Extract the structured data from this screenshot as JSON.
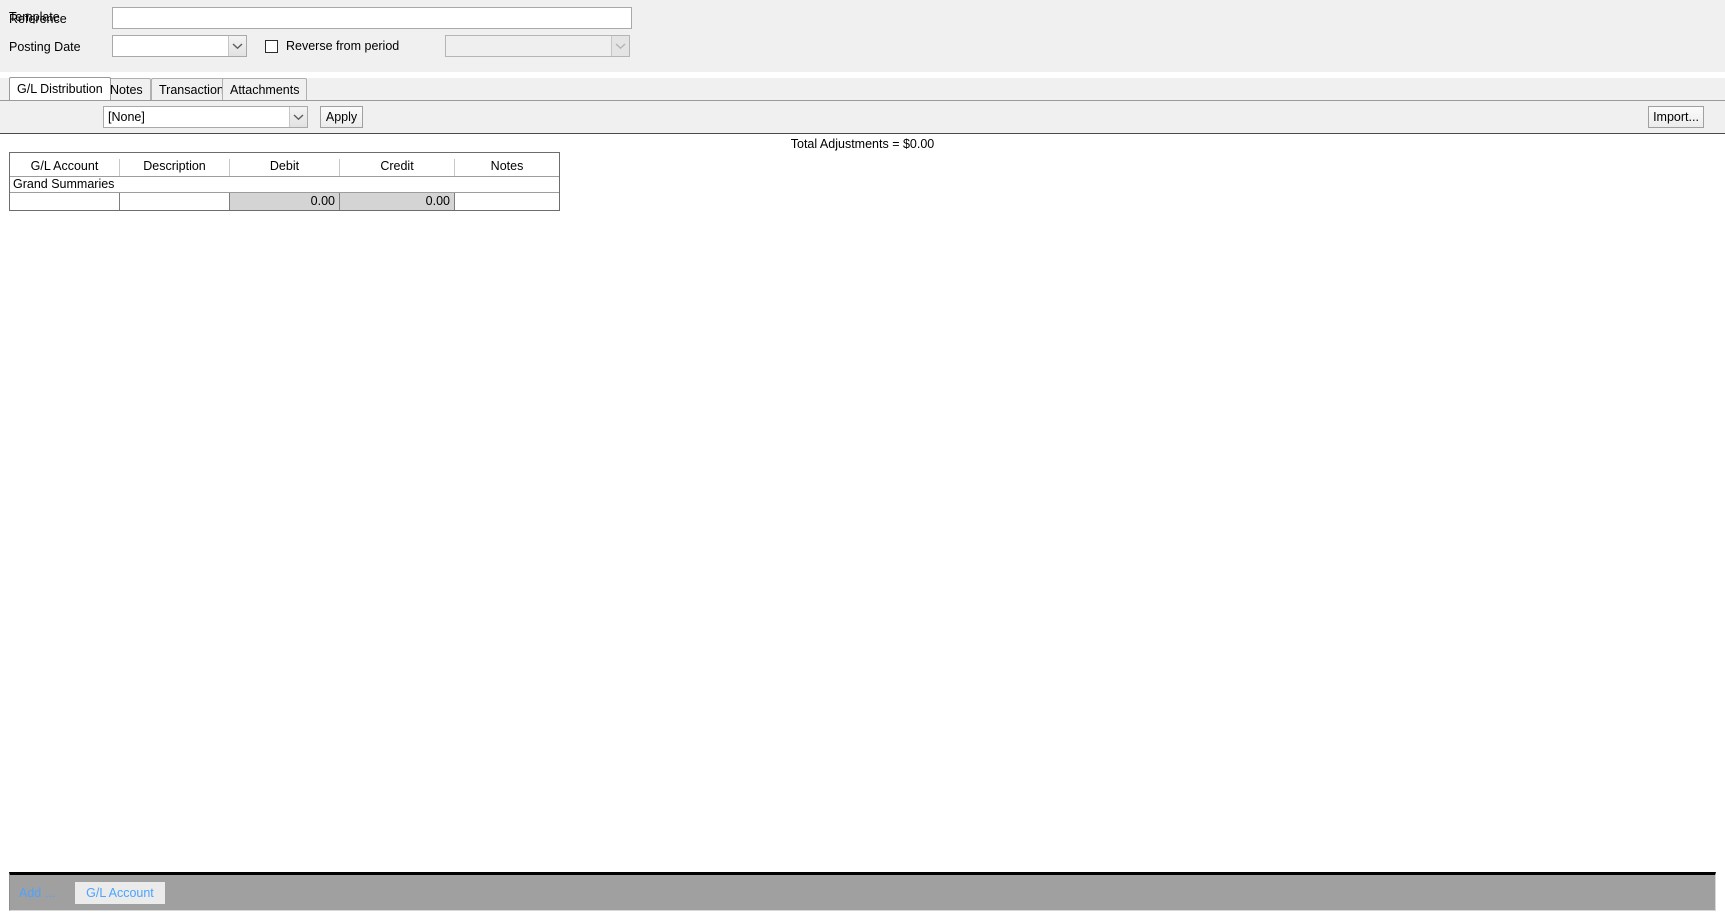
{
  "window": {
    "title": "G/L Distribution"
  },
  "header": {
    "reference": {
      "label": "Reference",
      "value": "",
      "placeholder": ""
    },
    "posting_date": {
      "label": "Posting Date",
      "value": "",
      "dropdown_icon": "chevron-down-icon"
    },
    "reverse_from_period": {
      "label": "Reverse from period",
      "checked": false
    },
    "period_select": {
      "value": "",
      "disabled": true,
      "dropdown_icon": "chevron-down-icon"
    }
  },
  "tabs": [
    {
      "label": "G/L Distribution",
      "active": true
    },
    {
      "label": "Notes",
      "active": false
    },
    {
      "label": "Transactions",
      "active": false
    },
    {
      "label": "Attachments",
      "active": false
    }
  ],
  "toolbar": {
    "template_label": "Template",
    "template_value": "[None]",
    "template_dropdown_icon": "chevron-down-icon",
    "apply_label": "Apply",
    "import_label": "Import..."
  },
  "main": {
    "total_adjustments": "Total Adjustments = $0.00"
  },
  "grid": {
    "columns": [
      {
        "key": "account",
        "label": "G/L Account"
      },
      {
        "key": "description",
        "label": "Description"
      },
      {
        "key": "debit",
        "label": "Debit"
      },
      {
        "key": "credit",
        "label": "Credit"
      },
      {
        "key": "notes",
        "label": "Notes"
      }
    ],
    "group_label": "Grand Summaries",
    "summary_row": {
      "account": "",
      "description": "",
      "debit": "0.00",
      "credit": "0.00",
      "notes": ""
    }
  },
  "footer": {
    "add_label": "Add ...",
    "add_button_label": "G/L Account"
  },
  "colors": {
    "chrome": "#f0f0f0",
    "content": "#ffffff",
    "footer_bar": "#a0a0a0",
    "footer_text": "#4da3ff",
    "grid_numeric_cell": "#d4d4d4",
    "grid_border": "#6d6d6d"
  }
}
